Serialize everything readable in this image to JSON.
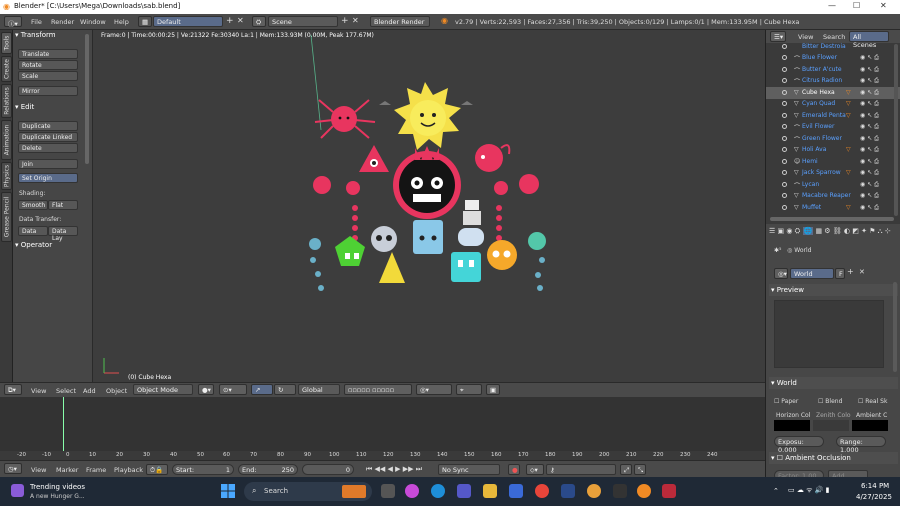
{
  "window": {
    "title": "Blender* [C:\\Users\\Mega\\Downloads\\sab.blend]"
  },
  "info_header": {
    "menus": [
      "File",
      "Render",
      "Window",
      "Help"
    ],
    "layout": "Default",
    "scene": "Scene",
    "engine": "Blender Render",
    "stats": "v2.79 | Verts:22,593 | Faces:27,356 | Tris:39,250 | Objects:0/129 | Lamps:0/1 | Mem:133.95M | Cube Hexa"
  },
  "tool_tabs": [
    "Tools",
    "Create",
    "Relations",
    "Animation",
    "Physics",
    "Grease Pencil"
  ],
  "tool_shelf": {
    "transform": {
      "header": "Transform",
      "buttons": [
        "Translate",
        "Rotate",
        "Scale",
        "Mirror"
      ]
    },
    "edit": {
      "header": "Edit",
      "buttons": [
        "Duplicate",
        "Duplicate Linked",
        "Delete",
        "Join",
        "Set Origin"
      ],
      "shading_label": "Shading:",
      "smooth": "Smooth",
      "flat": "Flat",
      "data_transfer_label": "Data Transfer:",
      "data": "Data",
      "data_lay": "Data Lay"
    },
    "operator": {
      "header": "Operator"
    }
  },
  "viewport": {
    "info": "Frame:0 | Time:00:00:25 | Ve:21322 Fe:30340 La:1 | Mem:133.93M (0.00M, Peak 177.67M)",
    "selected": "(0) Cube Hexa"
  },
  "view3d_header": {
    "menus": [
      "View",
      "Select",
      "Add",
      "Object"
    ],
    "mode": "Object Mode",
    "orientation": "Global"
  },
  "timeline": {
    "ticks": [
      "-20",
      "-10",
      "0",
      "10",
      "20",
      "30",
      "40",
      "50",
      "60",
      "70",
      "80",
      "90",
      "100",
      "110",
      "120",
      "130",
      "140",
      "150",
      "160",
      "170",
      "180",
      "190",
      "200",
      "210",
      "220",
      "230",
      "240"
    ],
    "menus": [
      "View",
      "Marker",
      "Frame",
      "Playback"
    ],
    "start_label": "Start:",
    "start": "1",
    "end_label": "End:",
    "end": "250",
    "current": "0",
    "sync": "No Sync"
  },
  "outliner": {
    "menus": [
      "View",
      "Search"
    ],
    "scope": "All Scenes",
    "items": [
      "Bitter Destroia",
      "Blue Flower",
      "Butter A'cute",
      "Citrus Radion",
      "Cube Hexa",
      "Cyan Quad",
      "Emerald Penta",
      "Evil Flower",
      "Green Flower",
      "Holi Ava",
      "Hemi",
      "Jack Sparrow",
      "Lycan",
      "Macabre Reaper",
      "Muffet"
    ]
  },
  "properties": {
    "world_label": "World",
    "world_name": "World",
    "world_f": "F",
    "preview": "Preview",
    "world_panel": "World",
    "paper": "Paper",
    "blend": "Blend",
    "real_sky": "Real Sk",
    "horizon": "Horizon Col",
    "zenith": "Zenith Colo",
    "ambient": "Ambient C",
    "exposure": "Exposu: 0.000",
    "range": "Range: 1.000",
    "ambient_occlusion": "Ambient Occlusion",
    "factor": "Factor: 1.00",
    "add": "Add"
  },
  "taskbar": {
    "news_title": "Trending videos",
    "news_sub": "A new Hunger G...",
    "search": "Search",
    "time": "6:14 PM",
    "date": "4/27/2025"
  },
  "colors": {
    "accent_blue": "#5aa0ff",
    "blender_orange": "#f08a24",
    "selected_row": "#5f7fbf",
    "world_black": "#000000"
  }
}
